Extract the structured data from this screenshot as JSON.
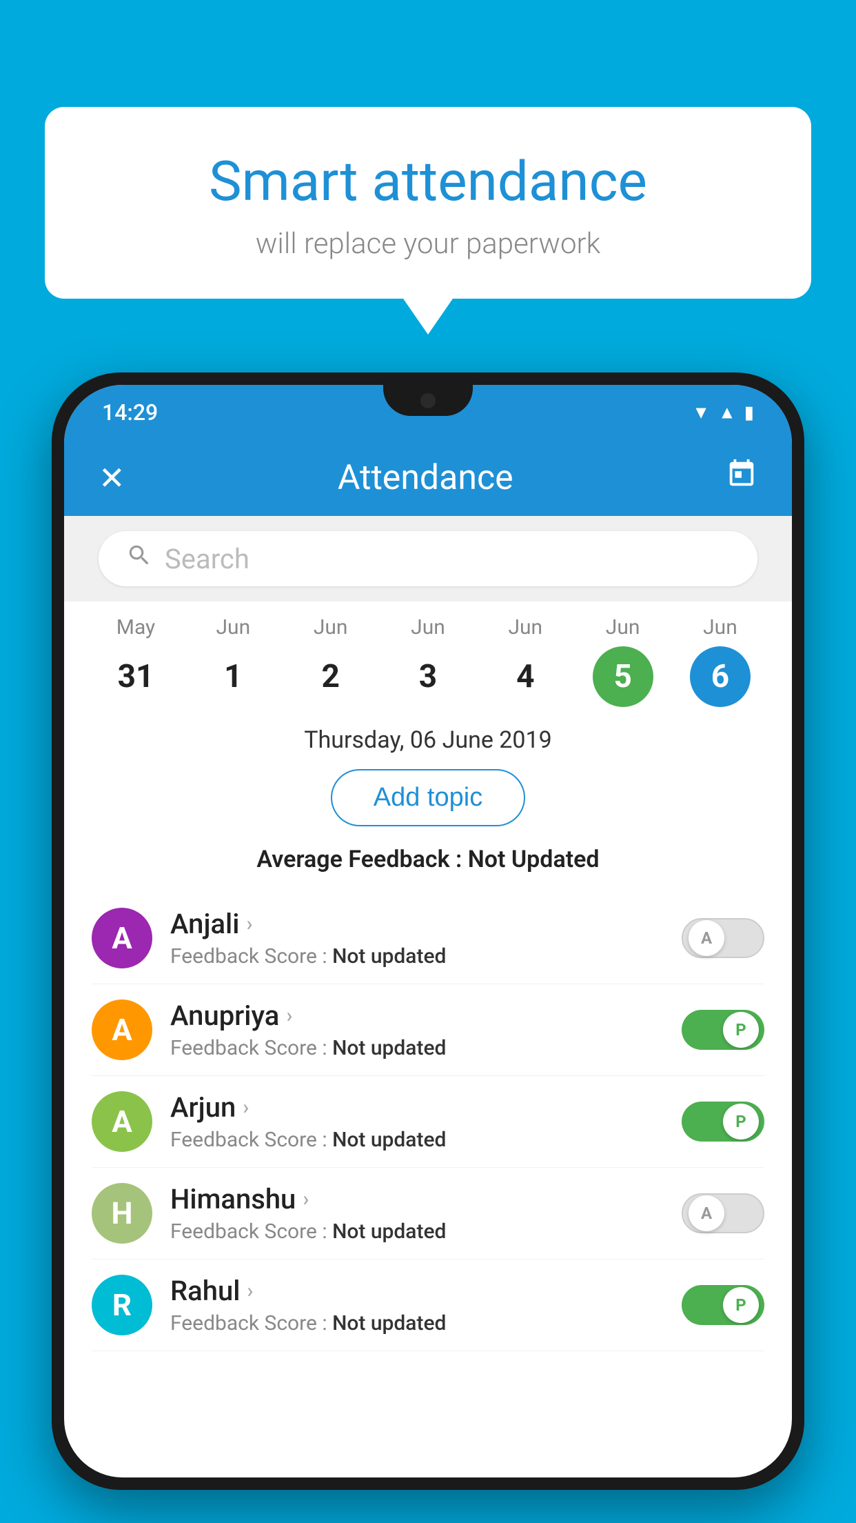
{
  "background_color": "#00AADD",
  "speech_bubble": {
    "title": "Smart attendance",
    "subtitle": "will replace your paperwork"
  },
  "status_bar": {
    "time": "14:29"
  },
  "app_bar": {
    "title": "Attendance",
    "close_label": "✕",
    "calendar_label": "📅"
  },
  "search": {
    "placeholder": "Search"
  },
  "calendar": {
    "days": [
      {
        "month": "May",
        "num": "31",
        "state": "normal"
      },
      {
        "month": "Jun",
        "num": "1",
        "state": "normal"
      },
      {
        "month": "Jun",
        "num": "2",
        "state": "normal"
      },
      {
        "month": "Jun",
        "num": "3",
        "state": "normal"
      },
      {
        "month": "Jun",
        "num": "4",
        "state": "normal"
      },
      {
        "month": "Jun",
        "num": "5",
        "state": "today"
      },
      {
        "month": "Jun",
        "num": "6",
        "state": "selected"
      }
    ]
  },
  "selected_date_label": "Thursday, 06 June 2019",
  "add_topic_button_label": "Add topic",
  "average_feedback_label": "Average Feedback :",
  "average_feedback_value": "Not Updated",
  "students": [
    {
      "name": "Anjali",
      "avatar_letter": "A",
      "avatar_color": "#9C27B0",
      "feedback_label": "Feedback Score :",
      "feedback_value": "Not updated",
      "attendance": "absent"
    },
    {
      "name": "Anupriya",
      "avatar_letter": "A",
      "avatar_color": "#FF9800",
      "feedback_label": "Feedback Score :",
      "feedback_value": "Not updated",
      "attendance": "present"
    },
    {
      "name": "Arjun",
      "avatar_letter": "A",
      "avatar_color": "#8BC34A",
      "feedback_label": "Feedback Score :",
      "feedback_value": "Not updated",
      "attendance": "present"
    },
    {
      "name": "Himanshu",
      "avatar_letter": "H",
      "avatar_color": "#A5C37A",
      "feedback_label": "Feedback Score :",
      "feedback_value": "Not updated",
      "attendance": "absent"
    },
    {
      "name": "Rahul",
      "avatar_letter": "R",
      "avatar_color": "#00BCD4",
      "feedback_label": "Feedback Score :",
      "feedback_value": "Not updated",
      "attendance": "present"
    }
  ]
}
